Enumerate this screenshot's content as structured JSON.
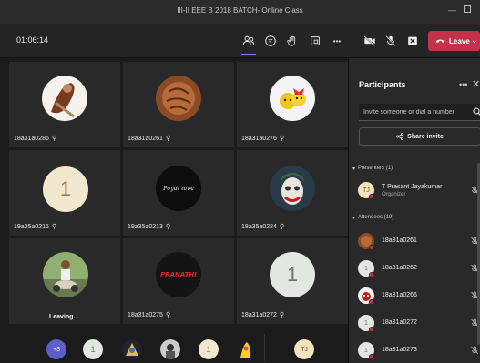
{
  "window": {
    "title": "III-II EEE B 2018 BATCH- Online Class",
    "minimize": "—"
  },
  "toolbar": {
    "timer": "01:06:14",
    "leave_label": "Leave",
    "more": "•••",
    "icons": [
      "people-icon",
      "chat-icon",
      "raise-hand-icon",
      "breakout-icon",
      "more-icon",
      "video-off-icon",
      "mic-off-icon",
      "share-tray-icon",
      "phone-icon"
    ]
  },
  "tiles": [
    {
      "name": "18a31a0286"
    },
    {
      "name": "18a31a0261"
    },
    {
      "name": "18a31a0276"
    },
    {
      "name": "19a35a0215",
      "initial": "1"
    },
    {
      "name": "19a35a0213",
      "logo": "Ρσyαℓ ℓσνє"
    },
    {
      "name": "18a35a0224"
    },
    {
      "status": "Leaving..."
    },
    {
      "name": "18a31a0275",
      "logo": "PRANATHI"
    },
    {
      "name": "18a31a0272",
      "initial": "1"
    }
  ],
  "strip": {
    "overflow": "+3",
    "initials": [
      "1",
      "1"
    ],
    "tj": "TJ"
  },
  "panel": {
    "title": "Participants",
    "more": "•••",
    "close": "✕",
    "invite_placeholder": "Invite someone or dial a number",
    "share_label": "Share invite",
    "presenters_label": "Presenters (1)",
    "attendees_label": "Attendees (19)",
    "presenter": {
      "initials": "TJ",
      "name": "T Prasant Jayakumar",
      "role": "Organizer"
    },
    "attendees": [
      {
        "name": "18a31a0261"
      },
      {
        "name": "18a31a0262",
        "initial": "1"
      },
      {
        "name": "18a31a0266"
      },
      {
        "name": "18a31a0272",
        "initial": "1"
      },
      {
        "name": "18a31a0273",
        "initial": "1"
      }
    ]
  },
  "colors": {
    "accent": "#7b83eb",
    "leave": "#c4314b",
    "background": "#1f1f1f",
    "tile": "#292929"
  }
}
